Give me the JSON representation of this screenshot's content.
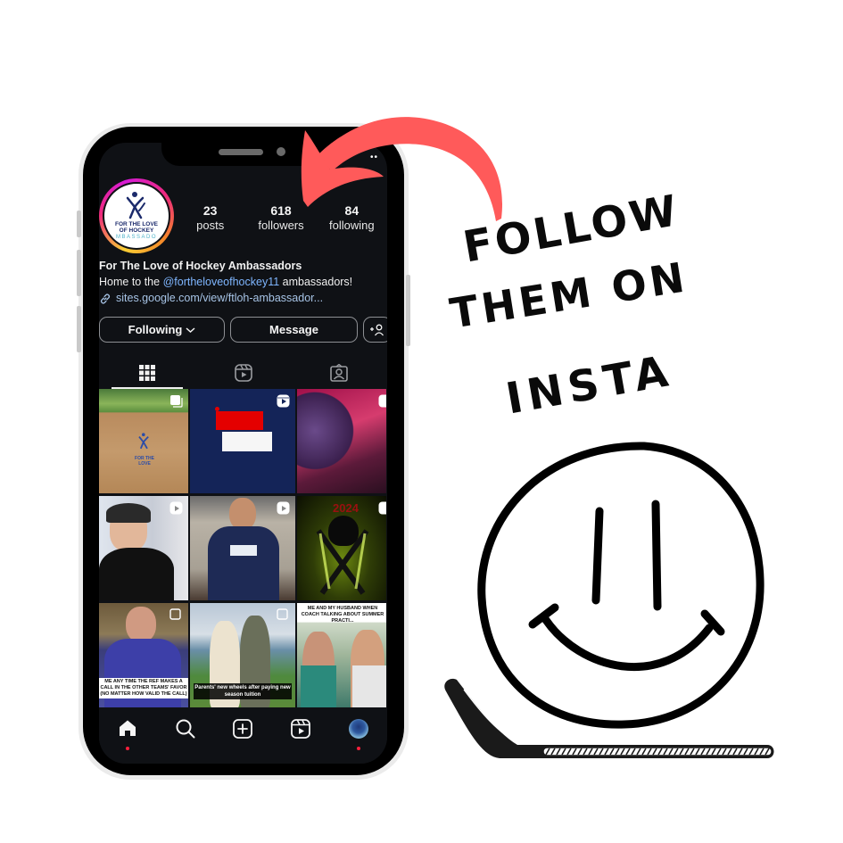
{
  "profile": {
    "avatar": {
      "line1": "FOR THE LOVE",
      "line2": "OF HOCKEY",
      "line3": "MBASSADO"
    },
    "stats": [
      {
        "value": "23",
        "label": "posts"
      },
      {
        "value": "618",
        "label": "followers"
      },
      {
        "value": "84",
        "label": "following"
      }
    ],
    "name": "For The Love of Hockey Ambassadors",
    "bio_prefix": "Home to the ",
    "bio_mention": "@fortheloveofhockey11",
    "bio_suffix": " ambassadors!",
    "link": "sites.google.com/view/ftloh-ambassador..."
  },
  "actions": {
    "following": "Following",
    "message": "Message",
    "suggest_icon": "add-person-icon"
  },
  "tabs": [
    {
      "name": "posts-grid",
      "icon": "grid-icon",
      "active": true
    },
    {
      "name": "reels",
      "icon": "reels-icon",
      "active": false
    },
    {
      "name": "tagged",
      "icon": "tagged-person-icon",
      "active": false
    }
  ],
  "grid_posts": [
    {
      "desc": "Box with FTLOH logo on lawn",
      "badge": "carousel",
      "logo_text": "FOR THE LOVE"
    },
    {
      "desc": "Red and white banner on navy",
      "badge": "reel"
    },
    {
      "desc": "Purple globe graphic",
      "badge": "reel"
    },
    {
      "desc": "Man in cap on video call",
      "badge": "reel"
    },
    {
      "desc": "Boy in navy t-shirt",
      "badge": "reel"
    },
    {
      "desc": "Skull with crossed hockey sticks",
      "badge": "reel",
      "overlay": "2024"
    },
    {
      "desc": "Man in purple suit meme",
      "badge": "carousel",
      "caption": "ME ANY TIME THE REF MAKES A CALL IN THE OTHER TEAMS' FAVOR (NO MATTER HOW VALID THE CALL)"
    },
    {
      "desc": "Couple with skateboard",
      "badge": "carousel",
      "caption": "Parents' new wheels after paying new season tuition"
    },
    {
      "desc": "Two hockey players meme",
      "badge": "carousel",
      "caption": "ME AND MY HUSBAND WHEN COACH TALKING ABOUT SUMMER PRACTI..."
    }
  ],
  "bottom_nav": [
    {
      "name": "home",
      "icon": "home-icon",
      "dot": true
    },
    {
      "name": "search",
      "icon": "search-icon",
      "dot": false
    },
    {
      "name": "create",
      "icon": "plus-square-icon",
      "dot": false
    },
    {
      "name": "reels",
      "icon": "reels-icon",
      "dot": false
    },
    {
      "name": "profile",
      "icon": "profile-avatar-icon",
      "dot": true
    }
  ],
  "status_bar": {
    "dots": "••"
  },
  "callout": {
    "line1": "FOLLOW",
    "line2": "THEM ON",
    "line3": "INSTA"
  },
  "colors": {
    "arrow": "#ff5a5a",
    "screen_bg": "#0f1115",
    "mention": "#7fb6ff",
    "notification_dot": "#ff1f3c"
  }
}
